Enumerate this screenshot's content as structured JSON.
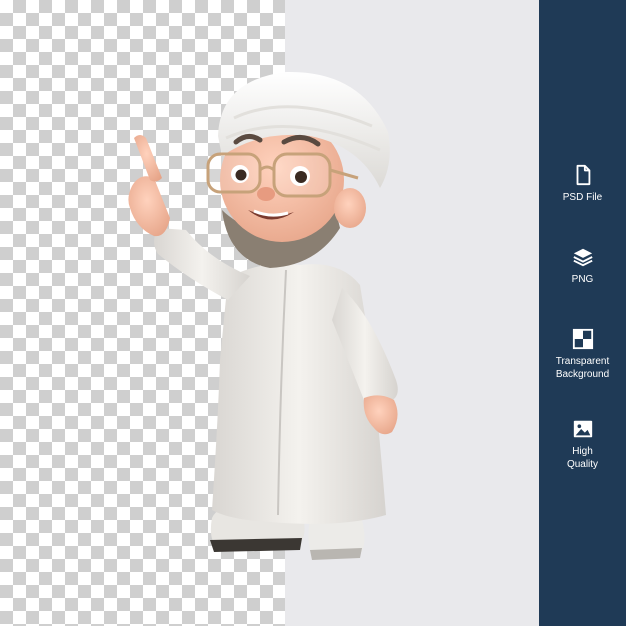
{
  "sidebar": {
    "background": "#1f3a56",
    "features": [
      {
        "icon": "file-icon",
        "label": "PSD File"
      },
      {
        "icon": "layers-icon",
        "label": "PNG"
      },
      {
        "icon": "checkerboard-icon",
        "label": "Transparent\nBackground"
      },
      {
        "icon": "image-icon",
        "label": "High\nQuality"
      }
    ]
  },
  "preview": {
    "left_background": "transparent-checkerboard",
    "right_background": "#e9e9ec",
    "subject": "3d-cartoon-man-pointing"
  }
}
